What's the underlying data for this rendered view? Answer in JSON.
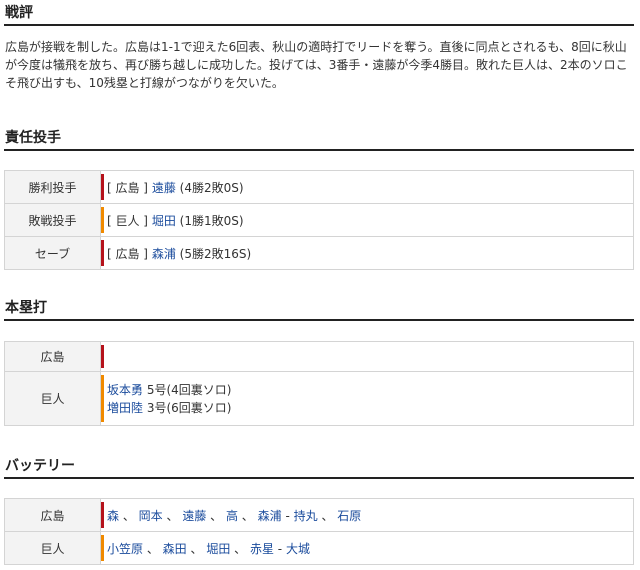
{
  "senpyo": {
    "title": "戦評",
    "text": "広島が接戦を制した。広島は1-1で迎えた6回表、秋山の適時打でリードを奪う。直後に同点とされるも、8回に秋山が今度は犠飛を放ち、再び勝ち越しに成功した。投げては、3番手・遠藤が今季4勝目。敗れた巨人は、2本のソロこそ飛び出すも、10残塁と打線がつながりを欠いた。"
  },
  "pitchers": {
    "title": "責任投手",
    "rows": [
      {
        "label": "勝利投手",
        "team": "[ 広島 ]",
        "name": "遠藤",
        "record": "(4勝2敗0S)",
        "color": "#b5121b"
      },
      {
        "label": "敗戦投手",
        "team": "[ 巨人 ]",
        "name": "堀田",
        "record": "(1勝1敗0S)",
        "color": "#f08a00"
      },
      {
        "label": "セーブ",
        "team": "[ 広島 ]",
        "name": "森浦",
        "record": "(5勝2敗16S)",
        "color": "#b5121b"
      }
    ]
  },
  "homeruns": {
    "title": "本塁打",
    "rows": [
      {
        "label": "広島",
        "color": "#b5121b",
        "entries": []
      },
      {
        "label": "巨人",
        "color": "#f08a00",
        "entries": [
          {
            "name": "坂本勇",
            "detail": "5号(4回裏ソロ)"
          },
          {
            "name": "増田陸",
            "detail": "3号(6回裏ソロ)"
          }
        ]
      }
    ]
  },
  "battery": {
    "title": "バッテリー",
    "rows": [
      {
        "label": "広島",
        "color": "#b5121b",
        "pitchers": [
          "森",
          "岡本",
          "遠藤",
          "高",
          "森浦"
        ],
        "catchers": [
          "持丸",
          "石原"
        ]
      },
      {
        "label": "巨人",
        "color": "#f08a00",
        "pitchers": [
          "小笠原",
          "森田",
          "堀田",
          "赤星"
        ],
        "catchers": [
          "大城"
        ]
      }
    ]
  }
}
